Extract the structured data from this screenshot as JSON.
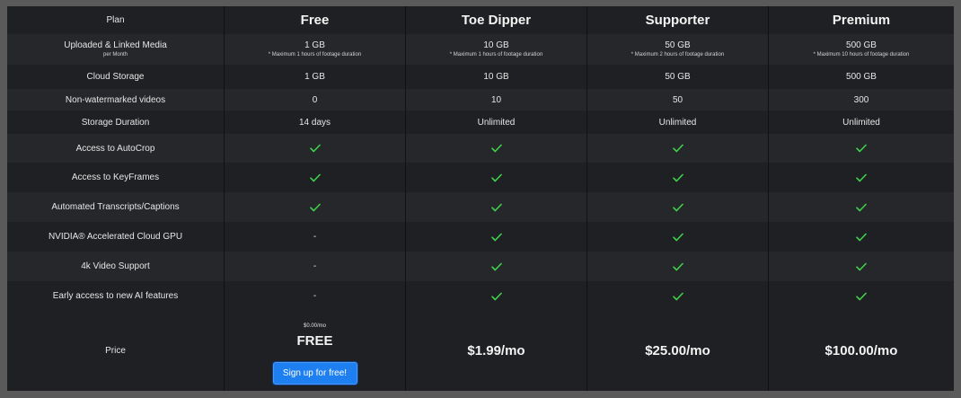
{
  "plans": [
    "Free",
    "Toe Dipper",
    "Supporter",
    "Premium"
  ],
  "rows": [
    {
      "label": "Plan"
    },
    {
      "label": "Uploaded & Linked Media",
      "sublabel": "per Month",
      "values": [
        {
          "main": "1 GB",
          "note": "* Maximum 1 hours of footage duration"
        },
        {
          "main": "10 GB",
          "note": "* Maximum 1 hours of footage duration"
        },
        {
          "main": "50 GB",
          "note": "* Maximum 2 hours of footage duration"
        },
        {
          "main": "500 GB",
          "note": "* Maximum 10 hours of footage duration"
        }
      ]
    },
    {
      "label": "Cloud Storage",
      "values": [
        "1 GB",
        "10 GB",
        "50 GB",
        "500 GB"
      ]
    },
    {
      "label": "Non-watermarked videos",
      "values": [
        "0",
        "10",
        "50",
        "300"
      ]
    },
    {
      "label": "Storage Duration",
      "values": [
        "14 days",
        "Unlimited",
        "Unlimited",
        "Unlimited"
      ]
    },
    {
      "label": "Access to AutoCrop",
      "values": [
        "check",
        "check",
        "check",
        "check"
      ]
    },
    {
      "label": "Access to KeyFrames",
      "values": [
        "check",
        "check",
        "check",
        "check"
      ]
    },
    {
      "label": "Automated Transcripts/Captions",
      "values": [
        "check",
        "check",
        "check",
        "check"
      ]
    },
    {
      "label": "NVIDIA® Accelerated Cloud GPU",
      "values": [
        "-",
        "check",
        "check",
        "check"
      ]
    },
    {
      "label": "4k Video Support",
      "values": [
        "-",
        "check",
        "check",
        "check"
      ]
    },
    {
      "label": "Early access to new AI features",
      "values": [
        "-",
        "check",
        "check",
        "check"
      ]
    }
  ],
  "price": {
    "label": "Price",
    "free_small": "$0.00/mo",
    "free_big": "FREE",
    "signup_label": "Sign up for free!",
    "toe_dipper": "$1.99/mo",
    "supporter": "$25.00/mo",
    "premium": "$100.00/mo"
  },
  "colors": {
    "check": "#3fd24a",
    "button": "#1e7ff0",
    "background": "#1f2023"
  }
}
